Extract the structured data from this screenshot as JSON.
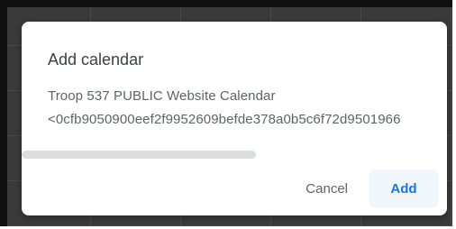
{
  "dialog": {
    "title": "Add calendar",
    "calendar_name": "Troop 537 PUBLIC Website Calendar",
    "calendar_id": "<0cfb9050900eef2f9952609befde378a0b5c6f72d9501966",
    "cancel_label": "Cancel",
    "add_label": "Add"
  },
  "scroll": {
    "horizontal_position_fraction": 0.0,
    "visible_fraction": 0.55
  },
  "colors": {
    "title": "#3c4043",
    "body_text": "#5f6368",
    "accent": "#1a73e8",
    "add_button_bg": "#f1f6fd",
    "scrollbar": "#dadce0"
  }
}
